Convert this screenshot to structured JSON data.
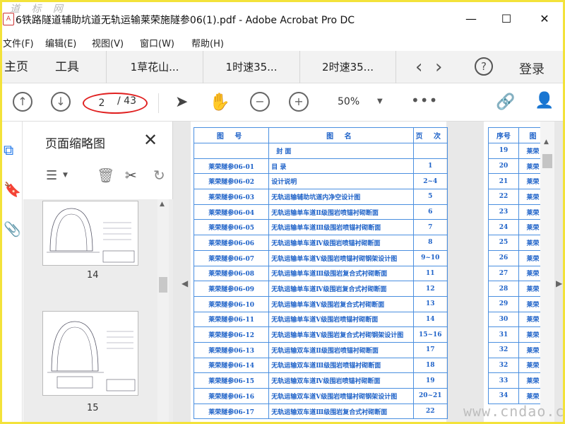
{
  "window": {
    "title": "6铁路隧道辅助坑道无轨运输莱荣施隧参06(1).pdf - Adobe Acrobat Pro DC",
    "app_icon": "acrobat-icon",
    "watermark": "道 标 网",
    "minimize": "—",
    "maximize": "☐",
    "close": "✕"
  },
  "menu": [
    "文件(F)",
    "编辑(E)",
    "视图(V)",
    "窗口(W)",
    "帮助(H)"
  ],
  "tabs": {
    "home": "主页",
    "tools": "工具",
    "docs": [
      "1草花山...",
      "1时速35...",
      "2时速35..."
    ],
    "login": "登录"
  },
  "toolbar": {
    "page_current": "2",
    "page_total": "/ 43",
    "zoom": "50%"
  },
  "panel": {
    "title": "页面缩略图",
    "close": "✕",
    "thumbs": [
      "14",
      "15"
    ]
  },
  "doc": {
    "headers": [
      "图 号",
      "图 名",
      "页 次"
    ],
    "rows": [
      {
        "id": "",
        "name": "封 面",
        "page": ""
      },
      {
        "id": "莱荣隧参06-01",
        "name": "目 录",
        "page": "1"
      },
      {
        "id": "莱荣隧参06-02",
        "name": "设计说明",
        "page": "2~4"
      },
      {
        "id": "莱荣隧参06-03",
        "name": "无轨运输辅助坑道内净空设计图",
        "page": "5"
      },
      {
        "id": "莱荣隧参06-04",
        "name": "无轨运输单车道Ⅱ级围岩喷锚衬砌断面",
        "page": "6"
      },
      {
        "id": "莱荣隧参06-05",
        "name": "无轨运输单车道Ⅲ级围岩喷锚衬砌断面",
        "page": "7"
      },
      {
        "id": "莱荣隧参06-06",
        "name": "无轨运输单车道Ⅳ级围岩喷锚衬砌断面",
        "page": "8"
      },
      {
        "id": "莱荣隧参06-07",
        "name": "无轨运输单车道Ⅴ级围岩喷锚衬砌钢架设计图",
        "page": "9~10"
      },
      {
        "id": "莱荣隧参06-08",
        "name": "无轨运输单车道Ⅲ级围岩复合式衬砌断面",
        "page": "11"
      },
      {
        "id": "莱荣隧参06-09",
        "name": "无轨运输单车道Ⅳ级围岩复合式衬砌断面",
        "page": "12"
      },
      {
        "id": "莱荣隧参06-10",
        "name": "无轨运输单车道Ⅴ级围岩复合式衬砌断面",
        "page": "13"
      },
      {
        "id": "莱荣隧参06-11",
        "name": "无轨运输单车道Ⅴ级围岩喷锚衬砌断面",
        "page": "14"
      },
      {
        "id": "莱荣隧参06-12",
        "name": "无轨运输单车道Ⅴ级围岩复合式衬砌钢架设计图",
        "page": "15~16"
      },
      {
        "id": "莱荣隧参06-13",
        "name": "无轨运输双车道Ⅱ级围岩喷锚衬砌断面",
        "page": "17"
      },
      {
        "id": "莱荣隧参06-14",
        "name": "无轨运输双车道Ⅲ级围岩喷锚衬砌断面",
        "page": "18"
      },
      {
        "id": "莱荣隧参06-15",
        "name": "无轨运输双车道Ⅳ级围岩喷锚衬砌断面",
        "page": "19"
      },
      {
        "id": "莱荣隧参06-16",
        "name": "无轨运输双车道Ⅴ级围岩喷锚衬砌钢架设计图",
        "page": "20~21"
      },
      {
        "id": "莱荣隧参06-17",
        "name": "无轨运输双车道Ⅲ级围岩复合式衬砌断面",
        "page": "22"
      }
    ],
    "right_headers": [
      "序号",
      "图"
    ],
    "right_rows": [
      [
        "19",
        "莱荣"
      ],
      [
        "20",
        "莱荣"
      ],
      [
        "21",
        "莱荣"
      ],
      [
        "22",
        "莱荣"
      ],
      [
        "23",
        "莱荣"
      ],
      [
        "24",
        "莱荣"
      ],
      [
        "25",
        "莱荣"
      ],
      [
        "26",
        "莱荣"
      ],
      [
        "27",
        "莱荣"
      ],
      [
        "28",
        "莱荣"
      ],
      [
        "29",
        "莱荣"
      ],
      [
        "30",
        "莱荣"
      ],
      [
        "31",
        "莱荣"
      ],
      [
        "32",
        "莱荣"
      ],
      [
        "32",
        "莱荣"
      ],
      [
        "33",
        "莱荣"
      ],
      [
        "34",
        "莱荣"
      ]
    ]
  },
  "footer_watermark": "www.cndao.com",
  "colors": {
    "accent": "#1a73e8",
    "annotation": "#e02020",
    "doc_lines": "#1e62c8",
    "frame": "#f3e23a"
  }
}
